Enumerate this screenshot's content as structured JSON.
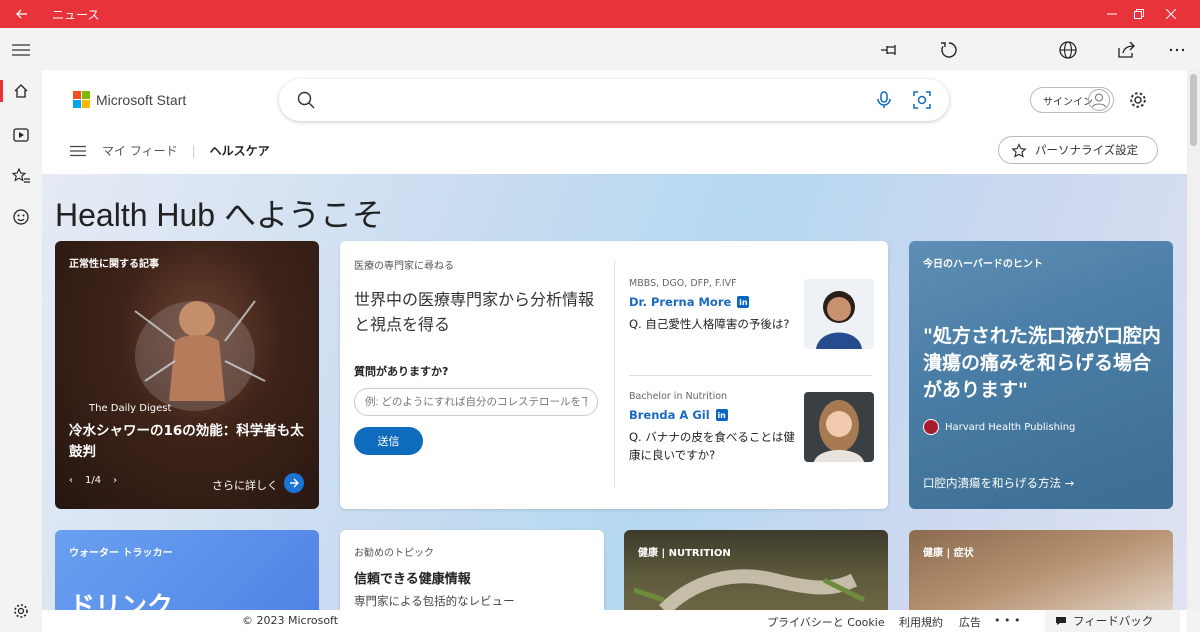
{
  "window": {
    "title": "ニュース"
  },
  "header": {
    "brand": "Microsoft Start",
    "search_placeholder": "",
    "signin": "サインイン",
    "nav_myfeed": "マイ フィード",
    "nav_current": "ヘルスケア",
    "personalize": "パーソナライズ設定"
  },
  "hub": {
    "title": "Health Hub へようこそ",
    "featured": {
      "tag": "正常性に関する記事",
      "source": "The Daily Digest",
      "headline": "冷水シャワーの16の効能：科学者も太鼓判",
      "pager": "1/4",
      "more": "さらに詳しく"
    },
    "ask": {
      "label": "医療の専門家に尋ねる",
      "heading": "世界中の医療専門家から分析情報と視点を得る",
      "question_label": "質問がありますか?",
      "input_placeholder": "例: どのようにすれば自分のコレステロールを下",
      "send": "送信",
      "experts": [
        {
          "credentials": "MBBS, DGO, DFP, F.IVF",
          "name": "Dr. Prerna More",
          "question": "Q. 自己愛性人格障害の予後は?"
        },
        {
          "credentials": "Bachelor in Nutrition",
          "name": "Brenda A Gil",
          "question": "Q. バナナの皮を食べることは健康に良いですか?"
        }
      ]
    },
    "harvard": {
      "tag": "今日のハーバードのヒント",
      "quote": "\"処方された洗口液が口腔内潰瘍の痛みを和らげる場合があります\"",
      "source": "Harvard Health Publishing",
      "link": "口腔内潰瘍を和らげる方法 →"
    },
    "water": {
      "tag": "ウォーター トラッカー",
      "big": "ドリンク"
    },
    "topics": {
      "label": "お勧めのトピック",
      "title": "信頼できる健康情報",
      "sub": "専門家による包括的なレビュー"
    },
    "nutrition": {
      "tag": "健康 | NUTRITION"
    },
    "symptoms": {
      "tag": "健康 | 症状"
    }
  },
  "footer": {
    "copyright": "© 2023 Microsoft",
    "privacy": "プライバシーと Cookie",
    "terms": "利用規約",
    "ads": "広告",
    "more": "• • •",
    "feedback": "フィードバック"
  },
  "colors": {
    "titlebar": "#e8333a",
    "accent": "#0f6cbd"
  }
}
